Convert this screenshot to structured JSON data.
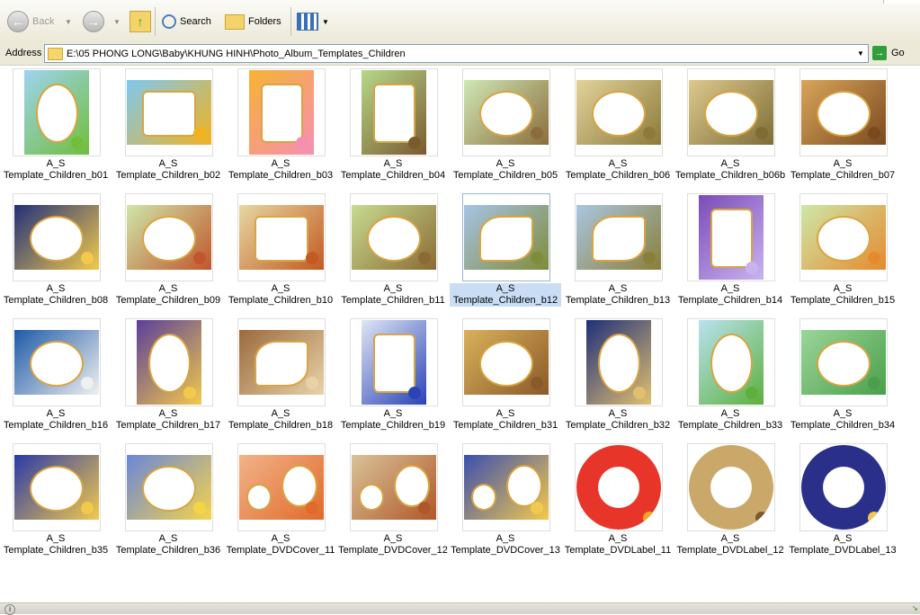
{
  "toolbar": {
    "back_label": "Back",
    "search_label": "Search",
    "folders_label": "Folders"
  },
  "address": {
    "label": "Address",
    "path": "E:\\05 PHONG LONG\\Baby\\KHUNG HINH\\Photo_Album_Templates_Children",
    "go_label": "Go"
  },
  "colors": {
    "toolbar_bg": "#ece9d8",
    "selection": "#c9def5",
    "go_green": "#2f9e3c"
  },
  "files": [
    {
      "line1": "A_S",
      "line2": "Template_Children_b01",
      "bg": "#9fd3f0",
      "frame": "ellipse",
      "accent": "#6fbf3a"
    },
    {
      "line1": "A_S",
      "line2": "Template_Children_b02",
      "bg": "#7ec8ef",
      "frame": "rect",
      "accent": "#f0b31f"
    },
    {
      "line1": "A_S",
      "line2": "Template_Children_b03",
      "bg": "#f7b333",
      "frame": "rect",
      "accent": "#f58fb1"
    },
    {
      "line1": "A_S",
      "line2": "Template_Children_b04",
      "bg": "#b6d88a",
      "frame": "rect",
      "accent": "#7b5a2e"
    },
    {
      "line1": "A_S",
      "line2": "Template_Children_b05",
      "bg": "#cfe8b5",
      "frame": "ellipse",
      "accent": "#8b6d3c"
    },
    {
      "line1": "A_S",
      "line2": "Template_Children_b06",
      "bg": "#e2d39a",
      "frame": "ellipse",
      "accent": "#8d7a3a"
    },
    {
      "line1": "A_S",
      "line2": "Template_Children_b06b",
      "bg": "#ddc98d",
      "frame": "ellipse",
      "accent": "#7d6d35"
    },
    {
      "line1": "A_S",
      "line2": "Template_Children_b07",
      "bg": "#d9a55a",
      "frame": "ellipse",
      "accent": "#7a4a1f"
    },
    {
      "line1": "A_S",
      "line2": "Template_Children_b08",
      "bg": "#21307a",
      "frame": "ellipse",
      "accent": "#f2c94c"
    },
    {
      "line1": "A_S",
      "line2": "Template_Children_b09",
      "bg": "#cfe6a9",
      "frame": "ellipse",
      "accent": "#c0572c"
    },
    {
      "line1": "A_S",
      "line2": "Template_Children_b10",
      "bg": "#e7d7a3",
      "frame": "rect",
      "accent": "#c25a22"
    },
    {
      "line1": "A_S",
      "line2": "Template_Children_b11",
      "bg": "#c7db8f",
      "frame": "ellipse",
      "accent": "#8a6b35"
    },
    {
      "line1": "A_S",
      "line2": "Template_Children_b12",
      "bg": "#a7c3e6",
      "frame": "leaf",
      "accent": "#7f8c3a"
    },
    {
      "line1": "A_S",
      "line2": "Template_Children_b13",
      "bg": "#aac6e0",
      "frame": "leaf",
      "accent": "#8a7f3a"
    },
    {
      "line1": "A_S",
      "line2": "Template_Children_b14",
      "bg": "#7b4bb8",
      "frame": "rect",
      "accent": "#c9b3ef"
    },
    {
      "line1": "A_S",
      "line2": "Template_Children_b15",
      "bg": "#cde8a8",
      "frame": "ellipse",
      "accent": "#e68a2e"
    },
    {
      "line1": "A_S",
      "line2": "Template_Children_b16",
      "bg": "#1e5aa8",
      "frame": "ellipse",
      "accent": "#f0f0f0"
    },
    {
      "line1": "A_S",
      "line2": "Template_Children_b17",
      "bg": "#5a3f9a",
      "frame": "ellipse",
      "accent": "#f2c94c"
    },
    {
      "line1": "A_S",
      "line2": "Template_Children_b18",
      "bg": "#9b6a3e",
      "frame": "leaf",
      "accent": "#e8d3a7"
    },
    {
      "line1": "A_S",
      "line2": "Template_Children_b19",
      "bg": "#dfe6f5",
      "frame": "rect",
      "accent": "#2a43b5"
    },
    {
      "line1": "A_S",
      "line2": "Template_Children_b31",
      "bg": "#d9b15a",
      "frame": "ellipse",
      "accent": "#8a5a2a"
    },
    {
      "line1": "A_S",
      "line2": "Template_Children_b32",
      "bg": "#1f2f7a",
      "frame": "ellipse",
      "accent": "#e0c070"
    },
    {
      "line1": "A_S",
      "line2": "Template_Children_b33",
      "bg": "#b9e2f0",
      "frame": "ellipse",
      "accent": "#5db03c"
    },
    {
      "line1": "A_S",
      "line2": "Template_Children_b34",
      "bg": "#9bd59a",
      "frame": "ellipse",
      "accent": "#4aa04a"
    },
    {
      "line1": "A_S",
      "line2": "Template_Children_b35",
      "bg": "#2a3aa8",
      "frame": "ellipse",
      "accent": "#f2c94c"
    },
    {
      "line1": "A_S",
      "line2": "Template_Children_b36",
      "bg": "#6a86d8",
      "frame": "ellipse",
      "accent": "#f5d44a"
    },
    {
      "line1": "A_S",
      "line2": "Template_DVDCover_11",
      "bg": "#f2b38a",
      "frame": "dvd",
      "accent": "#e06a2a"
    },
    {
      "line1": "A_S",
      "line2": "Template_DVDCover_12",
      "bg": "#d9c39a",
      "frame": "dvd",
      "accent": "#b0572a"
    },
    {
      "line1": "A_S",
      "line2": "Template_DVDCover_13",
      "bg": "#3c4fb0",
      "frame": "dvd",
      "accent": "#f2c94c"
    },
    {
      "line1": "A_S",
      "line2": "Template_DVDLabel_11",
      "bg": "#e8352a",
      "frame": "disc",
      "accent": "#f5a623"
    },
    {
      "line1": "A_S",
      "line2": "Template_DVDLabel_12",
      "bg": "#c9a86a",
      "frame": "disc",
      "accent": "#7a5a2a"
    },
    {
      "line1": "A_S",
      "line2": "Template_DVDLabel_13",
      "bg": "#2a2f8a",
      "frame": "disc",
      "accent": "#f2c94c"
    }
  ],
  "selected_index": 12
}
